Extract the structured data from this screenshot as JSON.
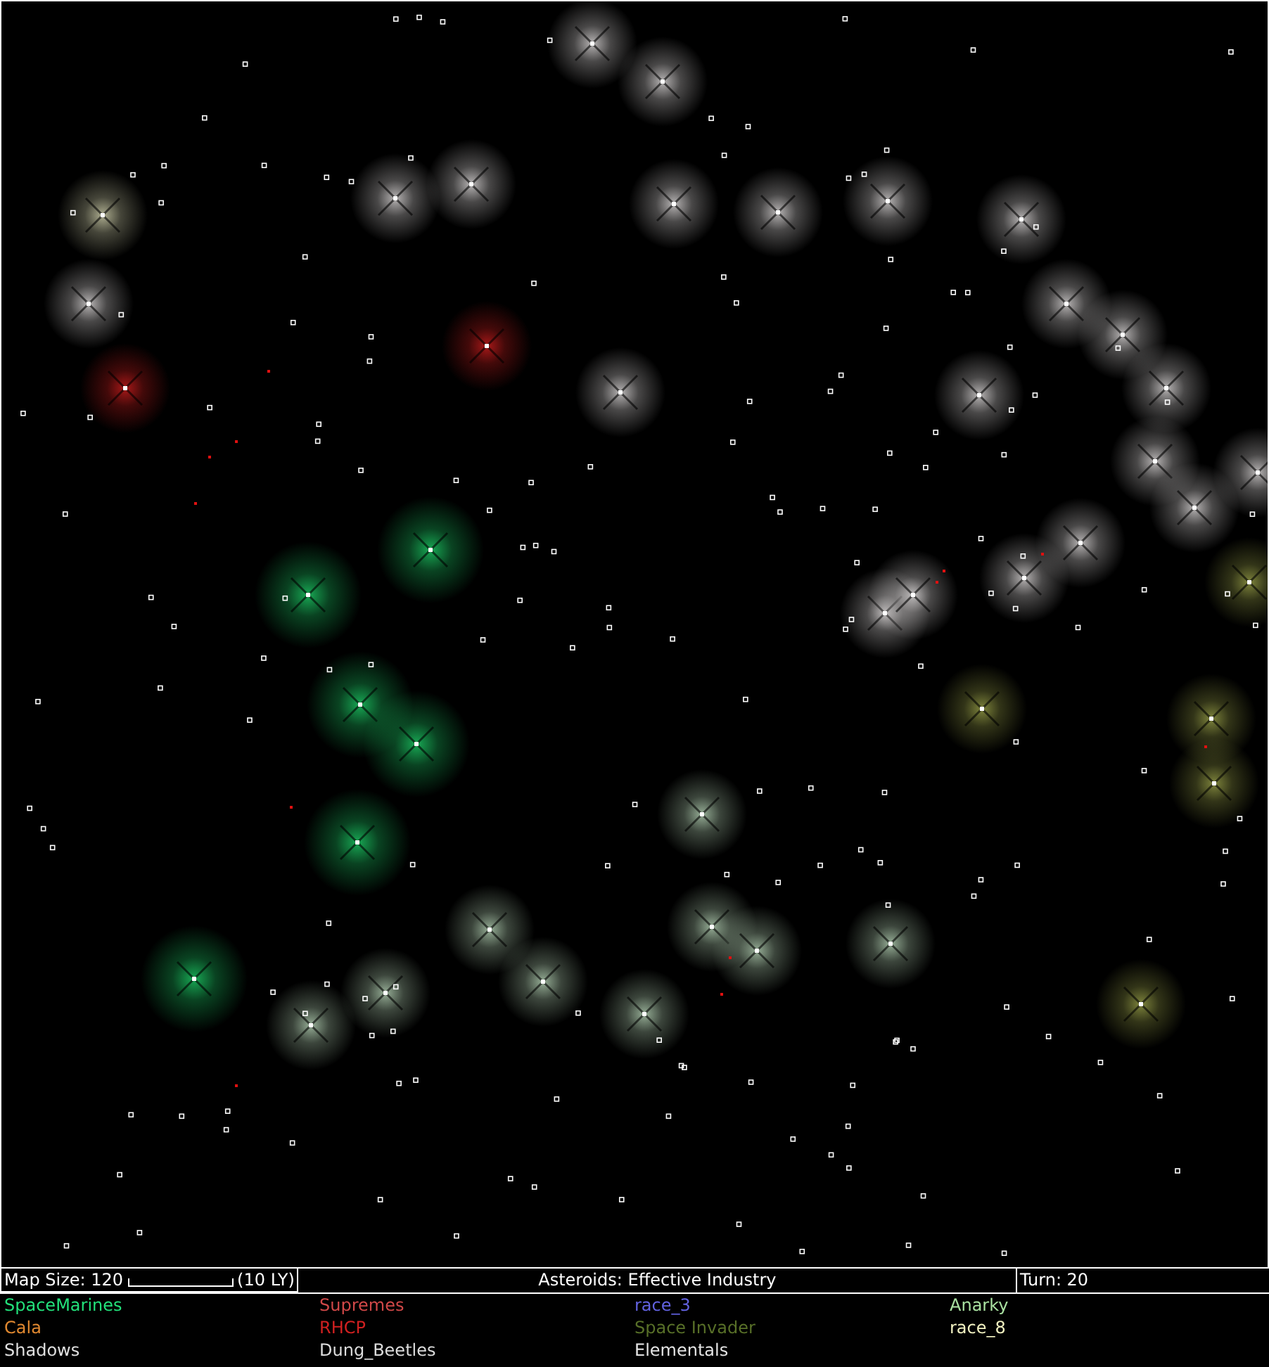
{
  "status_bar": {
    "map_size": "Map Size: 120",
    "scale_label": "(10 LY)",
    "message": "Asteroids: Effective Industry",
    "turn": "Turn: 20"
  },
  "races": [
    {
      "name": "SpaceMarines",
      "color": "#22e07a"
    },
    {
      "name": "Supremes",
      "color": "#d04848"
    },
    {
      "name": "race_3",
      "color": "#6262e0"
    },
    {
      "name": "Anarky",
      "color": "#a8e0a0"
    },
    {
      "name": "Cala",
      "color": "#e08830"
    },
    {
      "name": "RHCP",
      "color": "#d02020"
    },
    {
      "name": "Space Invader",
      "color": "#587028"
    },
    {
      "name": "race_8",
      "color": "#f0f0c0"
    },
    {
      "name": "Shadows",
      "color": "#e0e0e0"
    },
    {
      "name": "Dung_Beetles",
      "color": "#dcdcdc"
    },
    {
      "name": "Elementals",
      "color": "#e4e4e4"
    }
  ]
}
